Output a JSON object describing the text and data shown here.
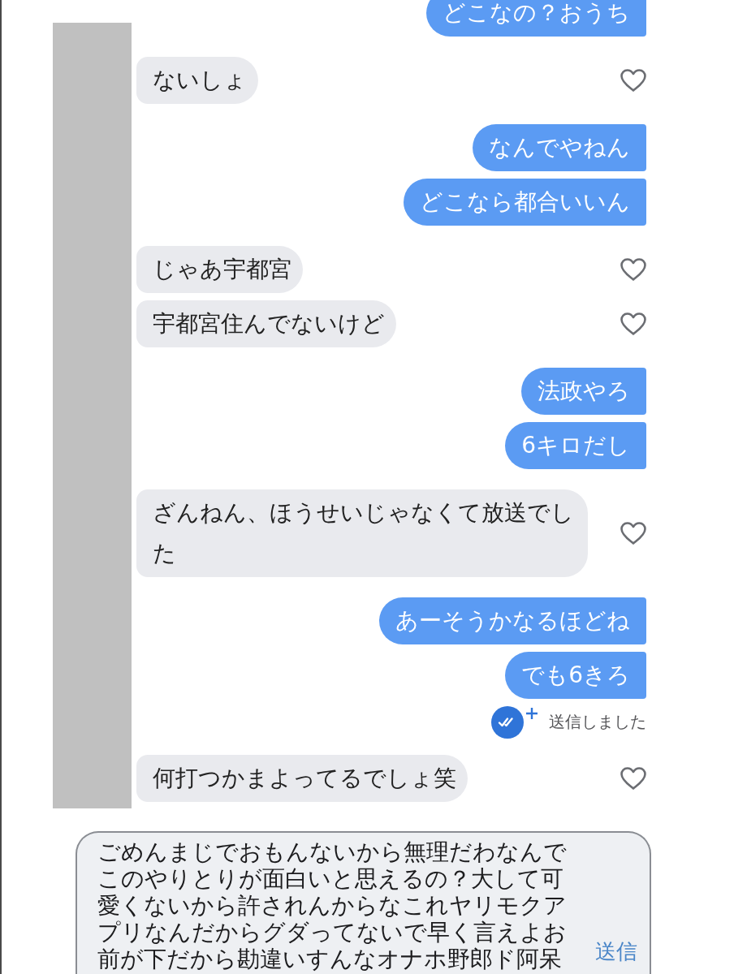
{
  "messages": [
    {
      "kind": "sent",
      "text": "どこなの？おうち"
    },
    {
      "kind": "received",
      "text": "ないしょ",
      "liked": false
    },
    {
      "kind": "sent",
      "text": "なんでやねん"
    },
    {
      "kind": "sent",
      "text": "どこなら都合いいん"
    },
    {
      "kind": "received",
      "text": "じゃあ宇都宮",
      "liked": false
    },
    {
      "kind": "received",
      "text": "宇都宮住んでないけど",
      "liked": false
    },
    {
      "kind": "sent",
      "text": "法政やろ"
    },
    {
      "kind": "sent",
      "text": "6キロだし"
    },
    {
      "kind": "received",
      "text": "ざんねん、ほうせいじゃなくて放送でした",
      "liked": false
    },
    {
      "kind": "sent",
      "text": "あーそうかなるほどね"
    },
    {
      "kind": "sent",
      "text": "でも6きろ"
    },
    {
      "kind": "receipt",
      "text": "送信しました"
    },
    {
      "kind": "received",
      "text": "何打つかまよってるでしょ笑",
      "liked": false
    }
  ],
  "compose": {
    "value": "ごめんまじでおもんないから無理だわなんでこのやりとりが面白いと思えるの？大して可愛くないから許されんからなこれヤリモクアプリなんだからグダってないで早く言えよお前が下だから勘違いすんなオナホ野郎ド阿呆",
    "send_label": "送信"
  }
}
